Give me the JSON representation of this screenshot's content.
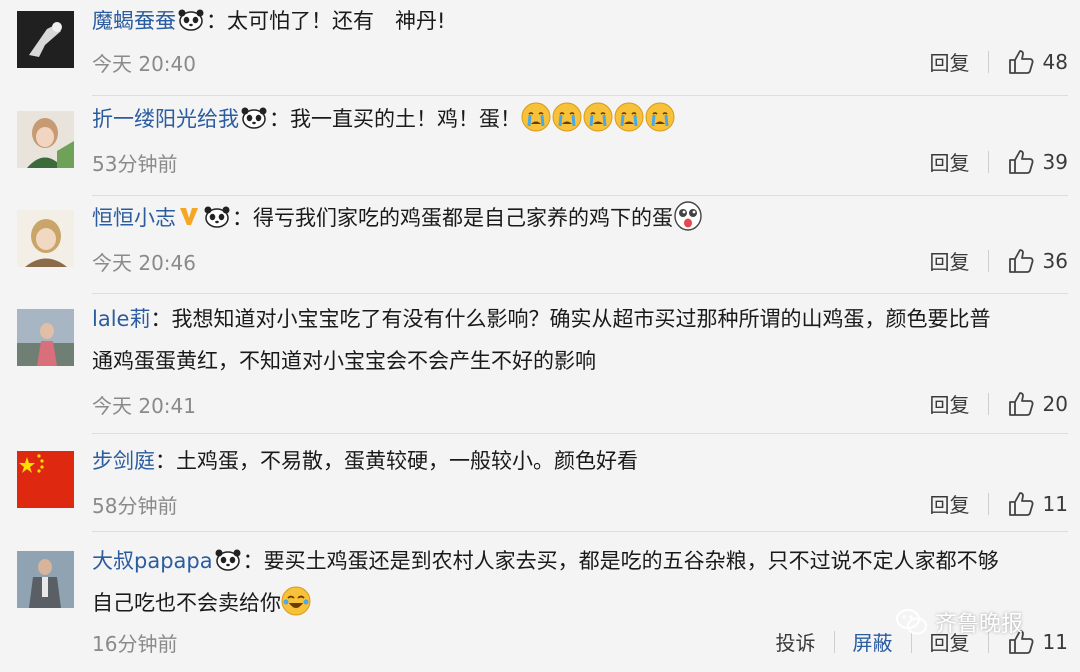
{
  "comments": [
    {
      "username": "魔蝎蚕蚕",
      "text": "太可怕了！还有　神丹!",
      "time": "今天 20:40",
      "reply": "回复",
      "likes": "48"
    },
    {
      "username": "折一缕阳光给我",
      "text": "我一直买的土！鸡！蛋！",
      "time": "53分钟前",
      "reply": "回复",
      "likes": "39"
    },
    {
      "username": "恒恒小志",
      "text": "得亏我们家吃的鸡蛋都是自己家养的鸡下的蛋",
      "time": "今天 20:46",
      "reply": "回复",
      "likes": "36"
    },
    {
      "username": "lale莉",
      "text_line1": "我想知道对小宝宝吃了有没有什么影响？确实从超市买过那种所谓的山鸡蛋，颜色要比普",
      "text_line2": "通鸡蛋蛋黄红，不知道对小宝宝会不会产生不好的影响",
      "time": "今天 20:41",
      "reply": "回复",
      "likes": "20"
    },
    {
      "username": "步剑庭",
      "text": "土鸡蛋，不易散，蛋黄较硬，一般较小。颜色好看",
      "time": "58分钟前",
      "reply": "回复",
      "likes": "11"
    },
    {
      "username": "大叔papapa",
      "text_line1": "要买土鸡蛋还是到农村人家去买，都是吃的五谷杂粮，只不过说不定人家都不够",
      "text_line2": "自己吃也不会卖给你",
      "time": "16分钟前",
      "report": "投诉",
      "block": "屏蔽",
      "reply": "回复",
      "likes": "11"
    }
  ],
  "watermark": "齐鲁晚报",
  "colors": {
    "username": "#2b5c9f",
    "time": "#8a8a8a",
    "background": "#f4f4f4",
    "divider": "#dedede"
  },
  "icons": [
    "panda-icon",
    "vip-badge-icon",
    "crying-emoji-icon",
    "surprised-emoji-icon",
    "laughing-emoji-icon",
    "thumbs-up-icon",
    "wechat-icon"
  ]
}
